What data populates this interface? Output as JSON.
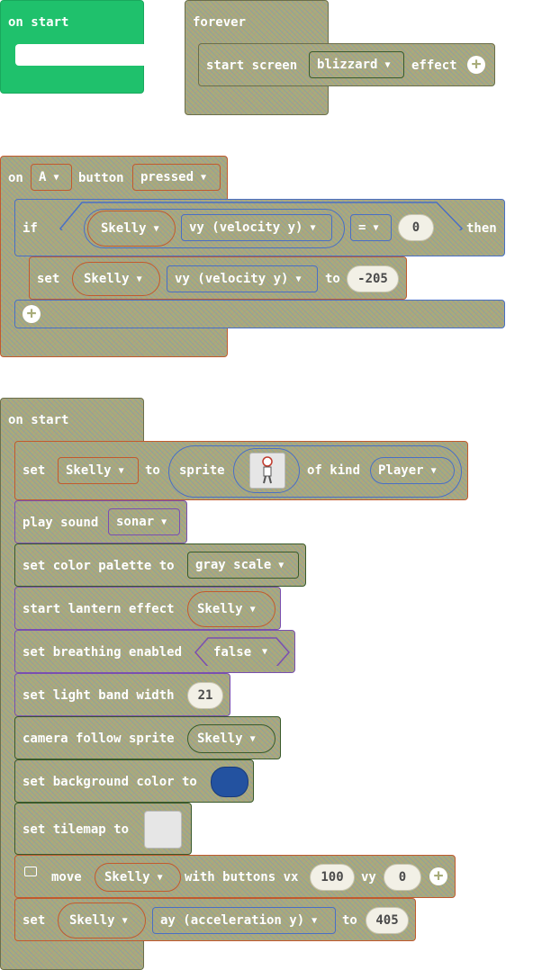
{
  "block1": {
    "label": "on start"
  },
  "block2": {
    "label": "forever",
    "start": "start screen",
    "effect_value": "blizzard",
    "effect": "effect"
  },
  "block3": {
    "on": "on",
    "button": "A",
    "button_label": "button",
    "event": "pressed",
    "if": "if",
    "sprite": "Skelly",
    "prop": "vy (velocity y)",
    "op": "=",
    "cmp": "0",
    "then": "then",
    "set": "set",
    "set_sprite": "Skelly",
    "set_prop": "vy (velocity y)",
    "to": "to",
    "set_value": "-205"
  },
  "block4": {
    "label": "on start",
    "r1": {
      "set": "set",
      "var": "Skelly",
      "to": "to",
      "sprite": "sprite",
      "of_kind": "of kind",
      "kind": "Player"
    },
    "r2": {
      "text": "play sound",
      "sound": "sonar"
    },
    "r3": {
      "text": "set color palette to",
      "palette": "gray scale"
    },
    "r4": {
      "text": "start lantern effect",
      "sprite": "Skelly"
    },
    "r5": {
      "text": "set breathing enabled",
      "value": "false"
    },
    "r6": {
      "text": "set light band width",
      "value": "21"
    },
    "r7": {
      "text": "camera follow sprite",
      "sprite": "Skelly"
    },
    "r8": {
      "text": "set background color to",
      "color": "#2352a0"
    },
    "r9": {
      "text": "set tilemap to"
    },
    "r10": {
      "move": "move",
      "sprite": "Skelly",
      "with": "with buttons vx",
      "vx": "100",
      "vy_label": "vy",
      "vy": "0"
    },
    "r11": {
      "set": "set",
      "sprite": "Skelly",
      "prop": "ay (acceleration y)",
      "to": "to",
      "value": "405"
    }
  }
}
